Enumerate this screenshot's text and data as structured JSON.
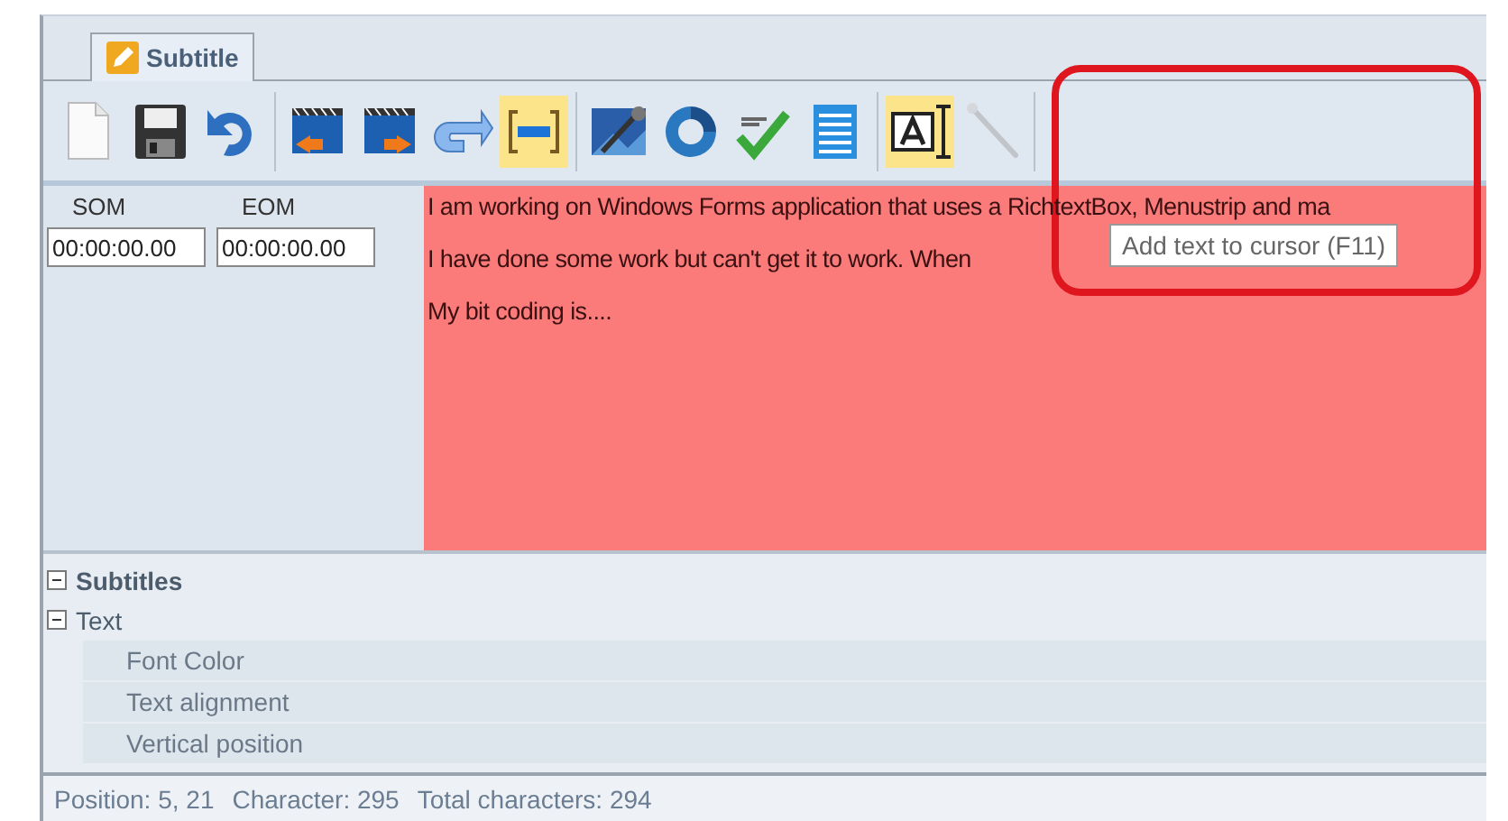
{
  "tab": {
    "label": "Subtitle"
  },
  "toolbar": {
    "groups": [
      [
        {
          "selected": false,
          "disabled": false
        },
        {
          "selected": false,
          "disabled": false
        },
        {
          "selected": false,
          "disabled": false
        }
      ],
      [
        {
          "selected": false,
          "disabled": false
        },
        {
          "selected": false,
          "disabled": false
        },
        {
          "selected": false,
          "disabled": false
        },
        {
          "selected": true,
          "disabled": false
        }
      ],
      [
        {
          "selected": false,
          "disabled": false
        },
        {
          "selected": false,
          "disabled": false
        },
        {
          "selected": false,
          "disabled": false
        },
        {
          "selected": false,
          "disabled": false
        }
      ],
      [
        {
          "selected": true,
          "disabled": false
        },
        {
          "selected": false,
          "disabled": true
        }
      ]
    ]
  },
  "tooltip": "Add text to cursor (F11)",
  "timecodes": [
    {
      "label": "SOM",
      "value": "00:00:00.00"
    },
    {
      "label": "EOM",
      "value": "00:00:00.00"
    }
  ],
  "editor": {
    "lines": [
      "I am working on Windows Forms application that uses a RichtextBox, Menustrip and ma",
      "I have done some work but can't get it to work. When",
      "My bit coding is...."
    ]
  },
  "properties": [
    {
      "label": "Subtitles",
      "expanded": true
    },
    {
      "label": "Text",
      "expanded": true,
      "children": [
        {
          "label": "Font Color"
        },
        {
          "label": "Text alignment"
        },
        {
          "label": "Vertical position"
        }
      ]
    }
  ],
  "status_bar": [
    "Position: 5, 21",
    "Character: 295",
    "Total characters: 294"
  ]
}
